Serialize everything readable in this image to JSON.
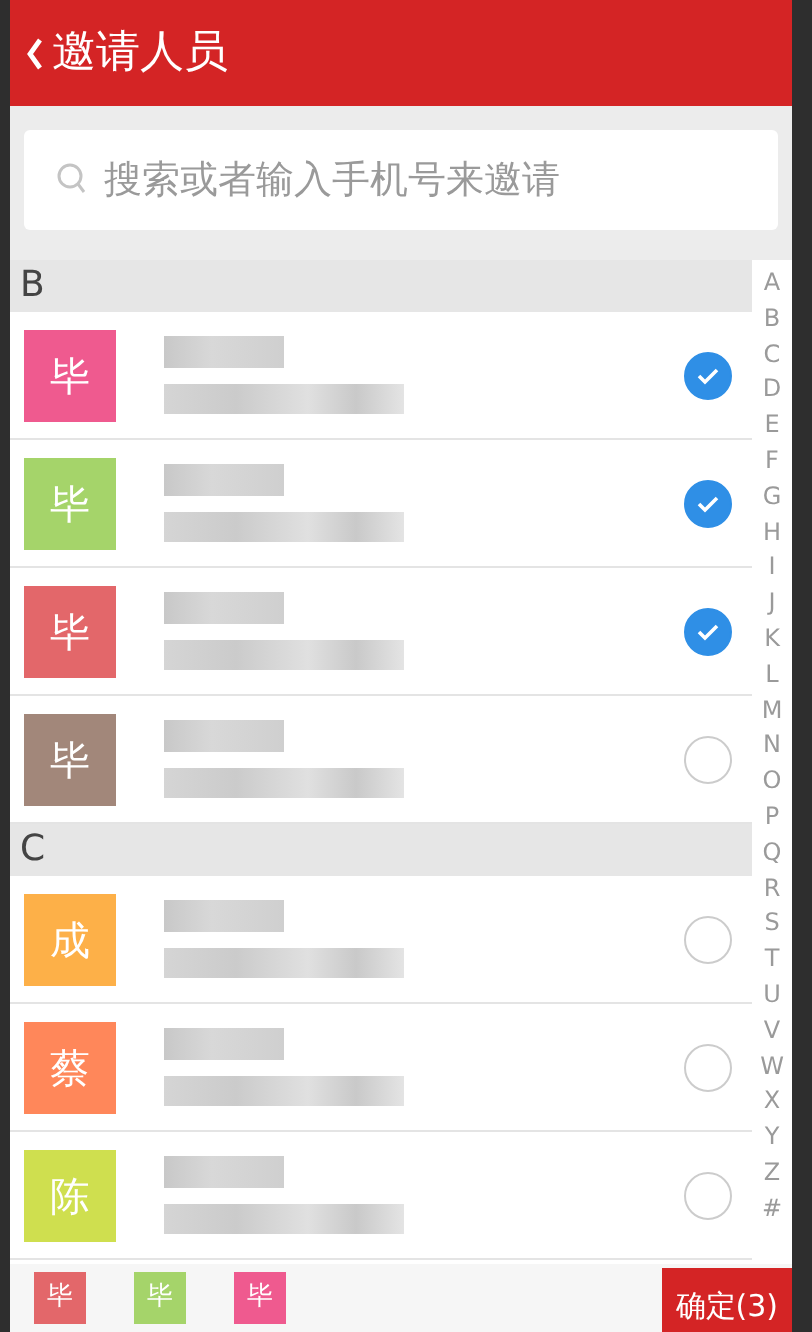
{
  "header": {
    "title": "邀请人员"
  },
  "search": {
    "placeholder": "搜索或者输入手机号来邀请"
  },
  "sections": [
    {
      "letter": "B",
      "contacts": [
        {
          "avatar": "毕",
          "color": "#ef5a8f",
          "selected": true
        },
        {
          "avatar": "毕",
          "color": "#a5d46a",
          "selected": true
        },
        {
          "avatar": "毕",
          "color": "#e3676a",
          "selected": true
        },
        {
          "avatar": "毕",
          "color": "#a2877a",
          "selected": false
        }
      ]
    },
    {
      "letter": "C",
      "contacts": [
        {
          "avatar": "成",
          "color": "#fdb048",
          "selected": false
        },
        {
          "avatar": "蔡",
          "color": "#ff875a",
          "selected": false
        },
        {
          "avatar": "陈",
          "color": "#cfdf4f",
          "selected": false
        }
      ]
    }
  ],
  "index": [
    "A",
    "B",
    "C",
    "D",
    "E",
    "F",
    "G",
    "H",
    "I",
    "J",
    "K",
    "L",
    "M",
    "N",
    "O",
    "P",
    "Q",
    "R",
    "S",
    "T",
    "U",
    "V",
    "W",
    "X",
    "Y",
    "Z",
    "#"
  ],
  "selected_bar": {
    "chips": [
      {
        "avatar": "毕",
        "color": "#e3676a"
      },
      {
        "avatar": "毕",
        "color": "#a5d46a"
      },
      {
        "avatar": "毕",
        "color": "#ef5a8f"
      }
    ],
    "confirm": "确定(3)"
  }
}
